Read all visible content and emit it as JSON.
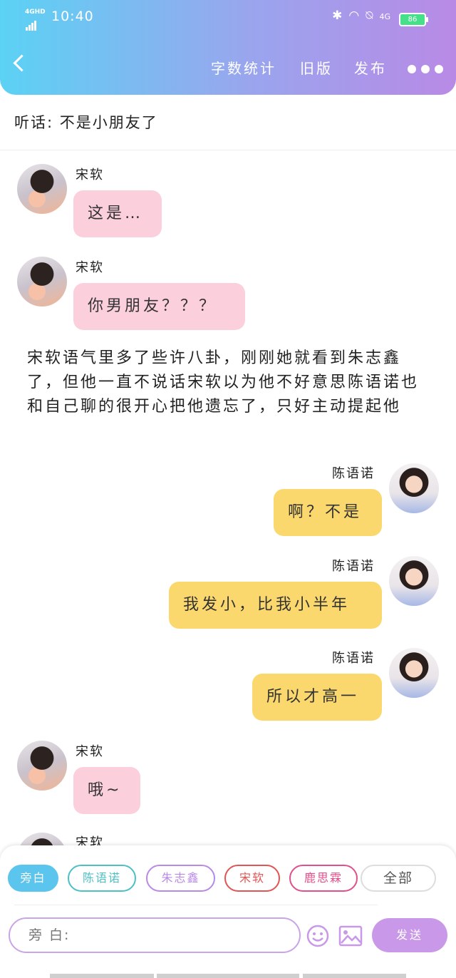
{
  "status": {
    "time": "10:40",
    "network": "4GHD",
    "battery": "86",
    "net_right": "4G"
  },
  "header": {
    "word_count": "字数统计",
    "old_version": "旧版",
    "publish": "发布"
  },
  "notice": "听话: 不是小朋友了",
  "messages": [
    {
      "speaker": "宋软",
      "text": "这是…"
    },
    {
      "speaker": "宋软",
      "text": "你男朋友？？？"
    },
    {
      "narration": "宋软语气里多了些许八卦，刚刚她就看到朱志鑫了，但他一直不说话宋软以为他不好意思陈语诺也和自己聊的很开心把他遗忘了，只好主动提起他"
    },
    {
      "speaker": "陈语诺",
      "text": "啊？不是"
    },
    {
      "speaker": "陈语诺",
      "text": "我发小，比我小半年"
    },
    {
      "speaker": "陈语诺",
      "text": "所以才高一"
    },
    {
      "speaker": "宋软",
      "text": "哦~"
    },
    {
      "speaker": "宋软",
      "text": ""
    }
  ],
  "chips": [
    {
      "label": "旁白",
      "color": "#5bc5ee"
    },
    {
      "label": "陈语诺",
      "color": "#4ec0c5"
    },
    {
      "label": "朱志鑫",
      "color": "#b88ae6"
    },
    {
      "label": "宋软",
      "color": "#e15555"
    },
    {
      "label": "鹿思霖",
      "color": "#e0508a"
    },
    {
      "label": "全部",
      "color": "#cccccc"
    }
  ],
  "input": {
    "placeholder": "旁 白:"
  },
  "send_label": "发送",
  "colors": {
    "pink_bubble": "#fbcfdc",
    "yellow_bubble": "#fbd86e",
    "accent": "#c998e8"
  }
}
